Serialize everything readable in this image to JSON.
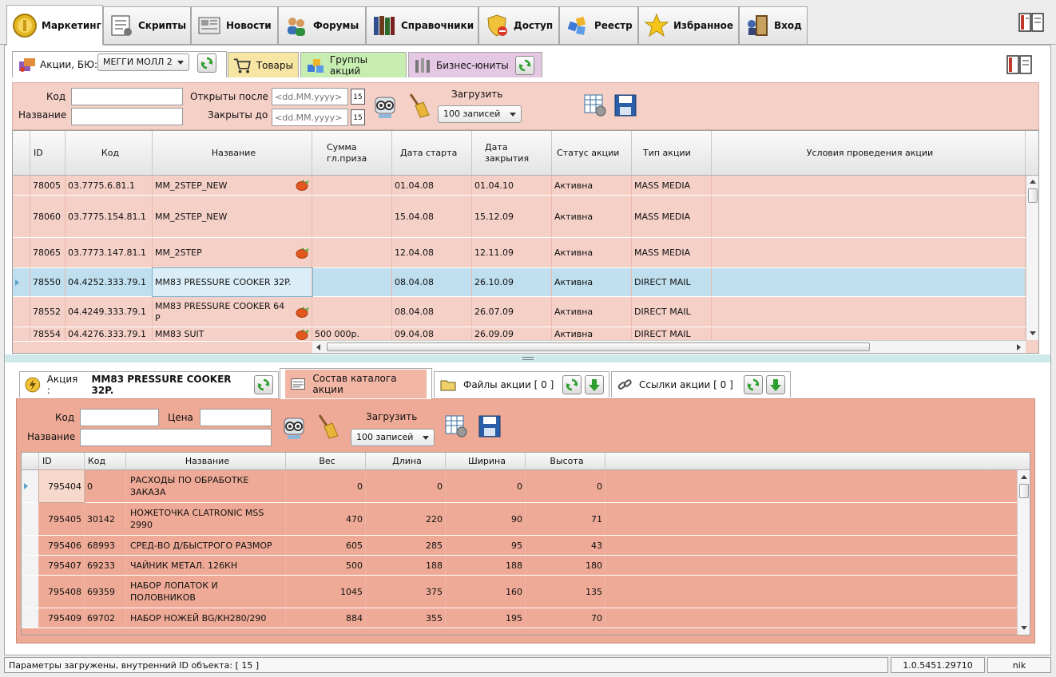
{
  "main_tabs": [
    {
      "label": "Маркетинг",
      "icon": "coin-icon"
    },
    {
      "label": "Скрипты",
      "icon": "script-icon"
    },
    {
      "label": "Новости",
      "icon": "newspaper-icon"
    },
    {
      "label": "Форумы",
      "icon": "users-icon"
    },
    {
      "label": "Справочники",
      "icon": "books-icon"
    },
    {
      "label": "Доступ",
      "icon": "shield-icon"
    },
    {
      "label": "Реестр",
      "icon": "registry-icon"
    },
    {
      "label": "Избранное",
      "icon": "star-icon"
    },
    {
      "label": "Вход",
      "icon": "login-door-icon"
    }
  ],
  "sub_tabs": {
    "actions_label": "Акции, БЮ:",
    "bu_selected": "МЕГГИ МОЛЛ 2",
    "goods": "Товары",
    "action_groups": "Группы акций",
    "business_units": "Бизнес-юниты"
  },
  "filter": {
    "code_label": "Код",
    "name_label": "Название",
    "opened_after_label": "Открыты после",
    "closed_before_label": "Закрыты до",
    "date_placeholder": "<dd.MM.yyyy>",
    "calendar_day": "15",
    "load_label": "Загрузить",
    "load_selected": "100 записей"
  },
  "actions_grid": {
    "columns": [
      "ID",
      "Код",
      "Название",
      "Сумма гл.приза",
      "Дата старта",
      "Дата закрытия",
      "Статус акции",
      "Тип акции",
      "Условия проведения акции"
    ],
    "rows": [
      {
        "id": "78005",
        "code": "03.7775.6.81.1",
        "name": "MM_2STEP_NEW",
        "prize": "",
        "start": "01.04.08",
        "end": "01.04.10",
        "status": "Активна",
        "type": "MASS MEDIA",
        "cond": "",
        "icon": true
      },
      {
        "id": "78060",
        "code": "03.7775.154.81.1",
        "name": "MM_2STEP_NEW",
        "prize": "",
        "start": "15.04.08",
        "end": "15.12.09",
        "status": "Активна",
        "type": "MASS MEDIA",
        "cond": "",
        "icon": false
      },
      {
        "id": "78065",
        "code": "03.7773.147.81.1",
        "name": "MM_2STEP",
        "prize": "",
        "start": "12.04.08",
        "end": "12.11.09",
        "status": "Активна",
        "type": "MASS MEDIA",
        "cond": "",
        "icon": true
      },
      {
        "id": "78550",
        "code": "04.4252.333.79.1",
        "name": "MM83 PRESSURE COOKER 32P.",
        "prize": "",
        "start": "08.04.08",
        "end": "26.10.09",
        "status": "Активна",
        "type": "DIRECT MAIL",
        "cond": "",
        "icon": false
      },
      {
        "id": "78552",
        "code": "04.4249.333.79.1",
        "name": "MM83 PRESSURE COOKER 64 P",
        "prize": "",
        "start": "08.04.08",
        "end": "26.07.09",
        "status": "Активна",
        "type": "DIRECT MAIL",
        "cond": "",
        "icon": true
      },
      {
        "id": "78554",
        "code": "04.4276.333.79.1",
        "name": "MM83 SUIT",
        "prize": "500 000р.",
        "start": "09.04.08",
        "end": "26.09.09",
        "status": "Активна",
        "type": "DIRECT MAIL",
        "cond": "",
        "icon": true
      }
    ]
  },
  "detail_tabs": {
    "action_label": "Акция :",
    "action_name": "MM83 PRESSURE COOKER 32P.",
    "catalog": "Состав каталога акции",
    "files": "Файлы акции [ 0 ]",
    "links": "Ссылки акции [ 0 ]"
  },
  "detail_filter": {
    "code_label": "Код",
    "price_label": "Цена",
    "name_label": "Название",
    "load_label": "Загрузить",
    "load_selected": "100 записей"
  },
  "catalog_grid": {
    "columns": [
      "ID",
      "Код",
      "Название",
      "Вес",
      "Длина",
      "Ширина",
      "Высота"
    ],
    "rows": [
      {
        "id": "795404",
        "code": "0",
        "name": "РАСХОДЫ ПО ОБРАБОТКЕ ЗАКАЗА",
        "w": "0",
        "l": "0",
        "wd": "0",
        "h": "0"
      },
      {
        "id": "795405",
        "code": "30142",
        "name": "НОЖЕТОЧКА CLATRONIC MSS 2990",
        "w": "470",
        "l": "220",
        "wd": "90",
        "h": "71"
      },
      {
        "id": "795406",
        "code": "68993",
        "name": "СРЕД-ВО Д/БЫСТРОГО РАЗМОР",
        "w": "605",
        "l": "285",
        "wd": "95",
        "h": "43"
      },
      {
        "id": "795407",
        "code": "69233",
        "name": "ЧАЙНИК МЕТАЛ. 126КН",
        "w": "500",
        "l": "188",
        "wd": "188",
        "h": "180"
      },
      {
        "id": "795408",
        "code": "69359",
        "name": "НАБОР ЛОПАТОК И ПОЛОВНИКОВ",
        "w": "1045",
        "l": "375",
        "wd": "160",
        "h": "135"
      },
      {
        "id": "795409",
        "code": "69702",
        "name": "НАБОР НОЖЕЙ BG/KH280/290",
        "w": "884",
        "l": "355",
        "wd": "195",
        "h": "70"
      }
    ]
  },
  "status_bar": {
    "message": "Параметры загружены, внутренний ID объекта: [ 15 ]",
    "version": "1.0.5451.29710",
    "user": "nik"
  },
  "colors": {
    "pink": "#f5d0c7",
    "salmon": "#eeaa96",
    "selected": "#bfdfee"
  }
}
